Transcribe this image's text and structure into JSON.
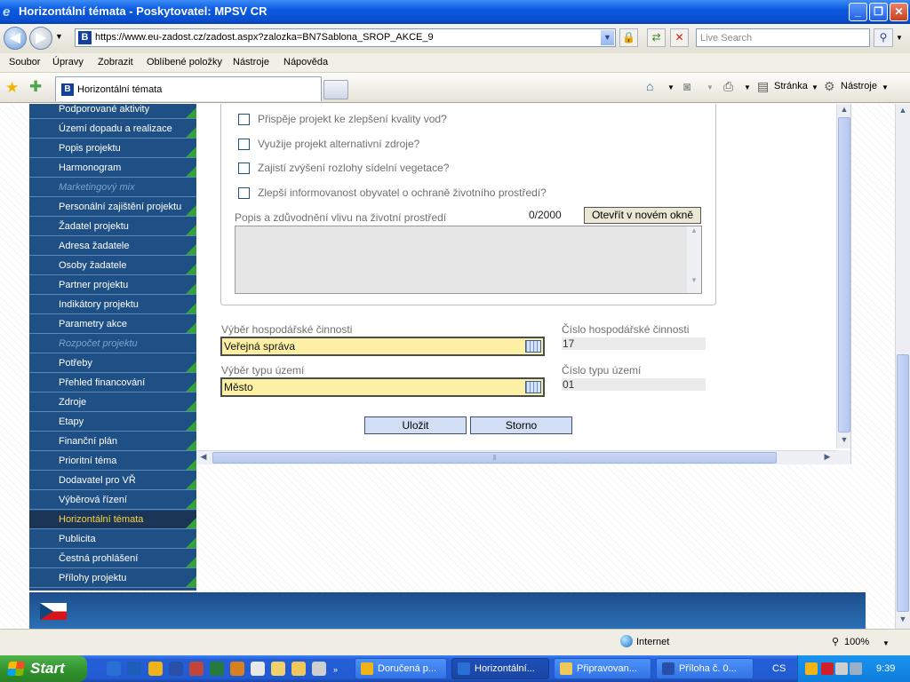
{
  "window": {
    "title": "Horizontální témata - Poskytovatel: MPSV CR",
    "minimize": "_",
    "maximize": "❐",
    "close": "✕"
  },
  "address": {
    "url": "https://www.eu-zadost.cz/zadost.aspx?zalozka=BN7Sablona_SROP_AKCE_9",
    "search_placeholder": "Live Search"
  },
  "menu": [
    "Soubor",
    "Úpravy",
    "Zobrazit",
    "Oblíbené položky",
    "Nástroje",
    "Nápověda"
  ],
  "tabs": {
    "active": "Horizontální témata"
  },
  "commands": {
    "page": "Stránka",
    "tools": "Nástroje"
  },
  "sidebar": {
    "items": [
      {
        "label": "Podporované aktivity",
        "state": "normal"
      },
      {
        "label": "Území dopadu a realizace",
        "state": "normal"
      },
      {
        "label": "Popis projektu",
        "state": "normal"
      },
      {
        "label": "Harmonogram",
        "state": "normal"
      },
      {
        "label": "Marketingový mix",
        "state": "disabled"
      },
      {
        "label": "Personální zajištění projektu",
        "state": "normal"
      },
      {
        "label": "Žadatel projektu",
        "state": "normal"
      },
      {
        "label": "Adresa žadatele",
        "state": "normal"
      },
      {
        "label": "Osoby žadatele",
        "state": "normal"
      },
      {
        "label": "Partner projektu",
        "state": "normal"
      },
      {
        "label": "Indikátory projektu",
        "state": "normal"
      },
      {
        "label": "Parametry akce",
        "state": "normal"
      },
      {
        "label": "Rozpočet projektu",
        "state": "disabled"
      },
      {
        "label": "Potřeby",
        "state": "normal"
      },
      {
        "label": "Přehled financování",
        "state": "normal"
      },
      {
        "label": "Zdroje",
        "state": "normal"
      },
      {
        "label": "Etapy",
        "state": "normal"
      },
      {
        "label": "Finanční plán",
        "state": "normal"
      },
      {
        "label": "Prioritní téma",
        "state": "normal"
      },
      {
        "label": "Dodavatel pro VŘ",
        "state": "normal"
      },
      {
        "label": "Výběrová řízení",
        "state": "normal"
      },
      {
        "label": "Horizontální témata",
        "state": "active"
      },
      {
        "label": "Publicita",
        "state": "normal"
      },
      {
        "label": "Čestná prohlášení",
        "state": "normal"
      },
      {
        "label": "Přílohy projektu",
        "state": "normal"
      }
    ]
  },
  "form": {
    "checkboxes": [
      {
        "label": "Přispěje projekt ke zlepšení kvality vod?",
        "checked": false
      },
      {
        "label": "Využije projekt alternativní zdroje?",
        "checked": false
      },
      {
        "label": "Zajistí zvýšení rozlohy sídelní vegetace?",
        "checked": false
      },
      {
        "label": "Zlepší informovanost obyvatel o ochraně životního prostředí?",
        "checked": false
      }
    ],
    "env_label": "Popis a zdůvodnění vlivu na životní prostředí",
    "env_counter": "0/2000",
    "open_new_window": "Otevřít v novém okně",
    "env_text": "",
    "activity_label": "Výběr hospodářské činnosti",
    "activity_value": "Veřejná správa",
    "activity_number_label": "Číslo hospodářské činnosti",
    "activity_number": "17",
    "territory_label": "Výběr typu území",
    "territory_value": "Město",
    "territory_number_label": "Číslo typu území",
    "territory_number": "01",
    "save": "Uložit",
    "cancel": "Storno"
  },
  "status": {
    "zone": "Internet",
    "zoom": "100%"
  },
  "taskbar": {
    "start": "Start",
    "items": [
      {
        "label": "Doručená p...",
        "active": false
      },
      {
        "label": "Horizontální...",
        "active": true
      },
      {
        "label": "Připravovan...",
        "active": false
      },
      {
        "label": "Příloha č. 0...",
        "active": false
      }
    ],
    "language": "CS",
    "clock": "9:39"
  },
  "colors": {
    "nav_bg": "#1e4f85",
    "nav_active_text": "#f5d54c",
    "select_bg": "#fdf0a4",
    "button_bg": "#d2def4"
  }
}
